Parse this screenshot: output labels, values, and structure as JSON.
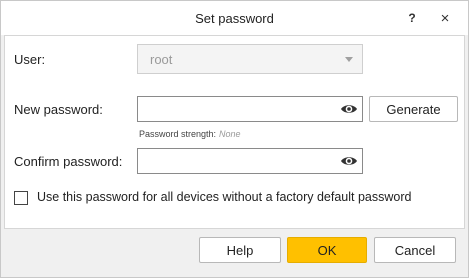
{
  "window": {
    "title": "Set password",
    "help_glyph": "?",
    "close_glyph": "×"
  },
  "form": {
    "user_label": "User:",
    "user_value": "root",
    "new_password_label": "New password:",
    "new_password_value": "",
    "generate_label": "Generate",
    "strength_label": "Password strength:",
    "strength_value": "None",
    "confirm_password_label": "Confirm password:",
    "confirm_password_value": "",
    "checkbox_label": "Use this password for all devices without a factory default password",
    "checkbox_checked": false
  },
  "footer": {
    "help_label": "Help",
    "ok_label": "OK",
    "cancel_label": "Cancel"
  },
  "colors": {
    "accent": "#ffc000",
    "content_bg": "#ffffff",
    "chrome_bg": "#f0f0f0"
  },
  "icons": {
    "show_password": "eye-icon",
    "dropdown": "chevron-down-icon"
  }
}
